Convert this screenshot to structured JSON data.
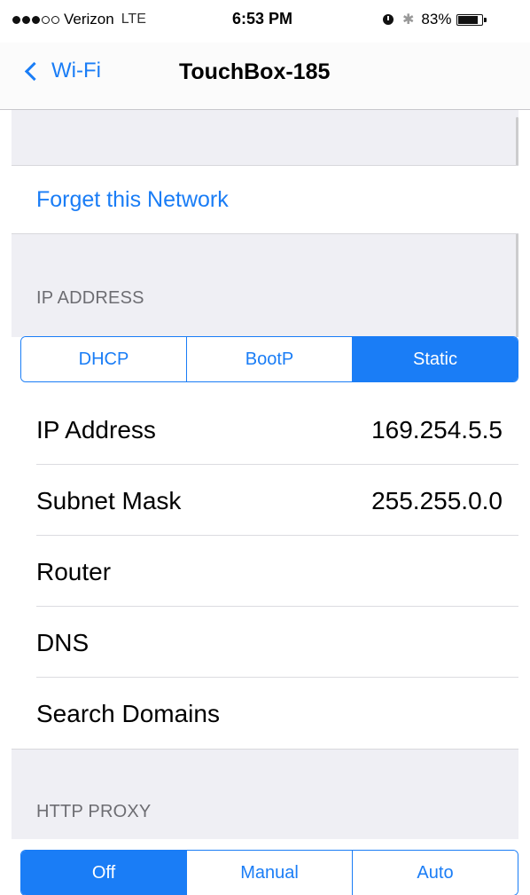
{
  "status_bar": {
    "carrier": "Verizon",
    "network": "LTE",
    "time": "6:53 PM",
    "battery_percent": "83%",
    "battery_level": 0.83,
    "signal_bars_filled": 3,
    "signal_bars_total": 5,
    "icons": [
      "alarm-icon",
      "bluetooth-icon",
      "battery-icon"
    ]
  },
  "nav": {
    "back_label": "Wi-Fi",
    "title": "TouchBox-185"
  },
  "forget_network_label": "Forget this Network",
  "ip_address_section": {
    "header": "IP ADDRESS",
    "modes": [
      "DHCP",
      "BootP",
      "Static"
    ],
    "selected_mode": "Static",
    "rows": [
      {
        "label": "IP Address",
        "value": "169.254.5.5"
      },
      {
        "label": "Subnet Mask",
        "value": "255.255.0.0"
      },
      {
        "label": "Router",
        "value": ""
      },
      {
        "label": "DNS",
        "value": ""
      },
      {
        "label": "Search Domains",
        "value": ""
      }
    ]
  },
  "http_proxy_section": {
    "header": "HTTP PROXY",
    "modes": [
      "Off",
      "Manual",
      "Auto"
    ],
    "selected_mode": "Off"
  },
  "colors": {
    "accent": "#1a7df6",
    "group_background": "#efeff4",
    "section_header_text": "#6d6d72"
  }
}
